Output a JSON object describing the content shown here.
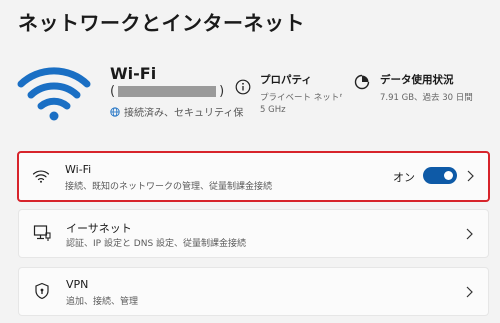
{
  "page": {
    "title": "ネットワークとインターネット"
  },
  "network": {
    "name": "Wi-Fi",
    "ssid_open": "(",
    "ssid_close": ")",
    "status": "接続済み、セキュリティ保"
  },
  "properties": {
    "title": "プロパティ",
    "line1": "プライベート ネットワーク",
    "line2": "5 GHz"
  },
  "data_usage": {
    "title": "データ使用状況",
    "subtitle": "7.91 GB、過去 30 日間"
  },
  "settings": [
    {
      "title": "Wi-Fi",
      "subtitle": "接続、既知のネットワークの管理、従量制課金接続",
      "toggle_label": "オン",
      "toggle_on": true,
      "highlight_color": "#d7242b"
    },
    {
      "title": "イーサネット",
      "subtitle": "認証、IP 設定と DNS 設定、従量制課金接続"
    },
    {
      "title": "VPN",
      "subtitle": "追加、接続、管理"
    }
  ],
  "colors": {
    "accent": "#0e5aa7",
    "wifi_icon": "#1a6fc4",
    "highlight": "#d7242b"
  },
  "icons": [
    "wifi-large-icon",
    "globe-icon",
    "info-icon",
    "data-usage-icon",
    "wifi-icon",
    "ethernet-icon",
    "vpn-shield-icon",
    "chevron-right-icon"
  ]
}
